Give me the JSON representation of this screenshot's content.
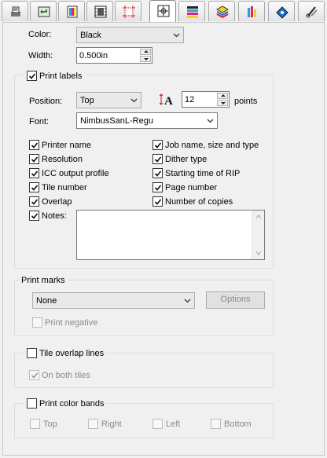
{
  "tabs": [
    {
      "icon": "printer-setup-icon"
    },
    {
      "icon": "media-load-icon"
    },
    {
      "icon": "color-profile-icon"
    },
    {
      "icon": "film-strip-icon"
    },
    {
      "icon": "crop-marks-icon"
    },
    {
      "icon": "marks-settings-icon"
    },
    {
      "icon": "color-bands-icon"
    },
    {
      "icon": "layers-icon"
    },
    {
      "icon": "color-bars-icon"
    },
    {
      "icon": "ink-drop-icon"
    },
    {
      "icon": "cut-icon"
    }
  ],
  "active_tab_index": 5,
  "color": {
    "label": "Color:",
    "value": "Black"
  },
  "width": {
    "label": "Width:",
    "value": "0.500in"
  },
  "print_labels": {
    "label": "Print labels",
    "checked": true,
    "position": {
      "label": "Position:",
      "value": "Top"
    },
    "font_size": {
      "value": "12",
      "unit": "points"
    },
    "font": {
      "label": "Font:",
      "value": "NimbusSanL-Regu"
    },
    "options_left": [
      {
        "label": "Printer name",
        "checked": true
      },
      {
        "label": "Resolution",
        "checked": true
      },
      {
        "label": "ICC output profile",
        "checked": true
      },
      {
        "label": "Tile number",
        "checked": true
      },
      {
        "label": "Overlap",
        "checked": true
      },
      {
        "label": "Notes:",
        "checked": true
      }
    ],
    "options_right": [
      {
        "label": "Job name, size and type",
        "checked": true
      },
      {
        "label": "Dither type",
        "checked": true
      },
      {
        "label": "Starting time of RIP",
        "checked": true
      },
      {
        "label": "Page number",
        "checked": true
      },
      {
        "label": "Number of copies",
        "checked": true
      }
    ],
    "notes_value": ""
  },
  "print_marks": {
    "label": "Print marks",
    "value": "None",
    "options_button": "Options",
    "print_negative": {
      "label": "Print negative",
      "checked": false,
      "enabled": false
    }
  },
  "tile_overlap": {
    "label": "Tile overlap lines",
    "checked": false,
    "on_both_tiles": {
      "label": "On both tiles",
      "checked": true,
      "enabled": false
    }
  },
  "color_bands": {
    "label": "Print color bands",
    "checked": false,
    "sides": [
      {
        "label": "Top",
        "checked": false
      },
      {
        "label": "Right",
        "checked": false
      },
      {
        "label": "Left",
        "checked": false
      },
      {
        "label": "Bottom",
        "checked": false
      }
    ]
  }
}
